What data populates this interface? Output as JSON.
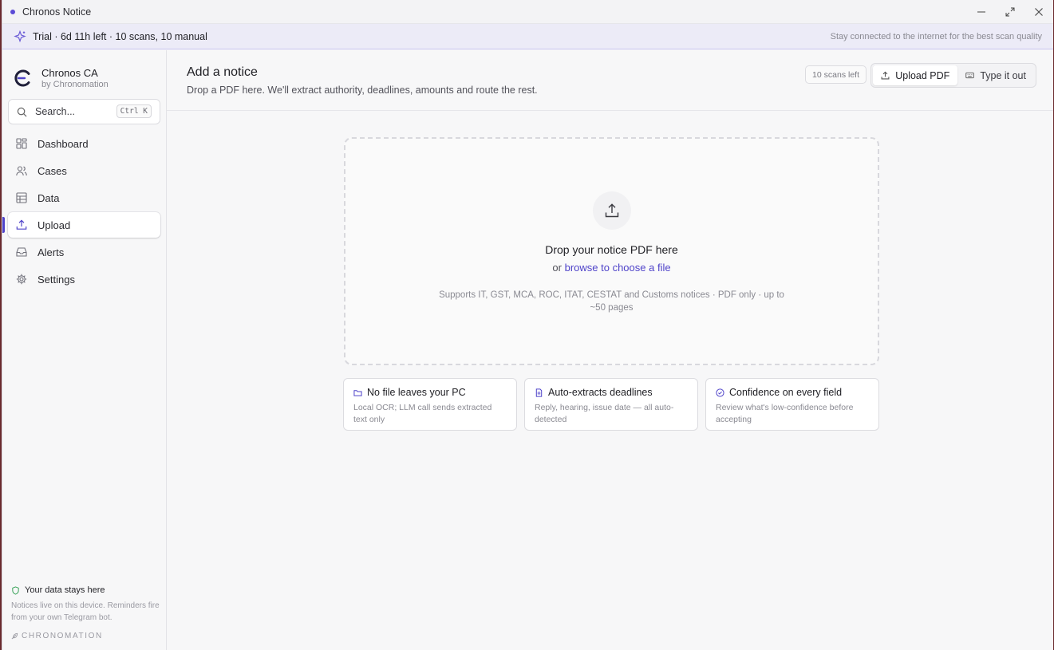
{
  "window": {
    "title": "Chronos Notice"
  },
  "trial": {
    "status": "Trial · 6d 11h left · 10 scans, 10 manual",
    "hint": "Stay connected to the internet for the best scan quality"
  },
  "brand": {
    "name": "Chronos CA",
    "sub": "by Chronomation"
  },
  "search": {
    "placeholder": "Search...",
    "shortcut": "Ctrl K"
  },
  "nav": [
    {
      "label": "Dashboard",
      "icon": "dashboard-icon"
    },
    {
      "label": "Cases",
      "icon": "users-icon"
    },
    {
      "label": "Data",
      "icon": "table-icon"
    },
    {
      "label": "Upload",
      "icon": "upload-icon",
      "active": true
    },
    {
      "label": "Alerts",
      "icon": "inbox-icon"
    },
    {
      "label": "Settings",
      "icon": "gear-icon"
    }
  ],
  "footer": {
    "title": "Your data stays here",
    "text": "Notices live on this device. Reminders fire from your own Telegram bot.",
    "brand": "CHRONOMATION"
  },
  "main": {
    "title": "Add a notice",
    "subtitle": "Drop a PDF here. We'll extract authority, deadlines, amounts and route the rest.",
    "scans_left": "10 scans left",
    "upload_pdf": "Upload PDF",
    "type_it_out": "Type it out"
  },
  "dropzone": {
    "title": "Drop your notice PDF here",
    "or": "or",
    "browse": "browse to choose a file",
    "support": "Supports IT, GST, MCA, ROC, ITAT, CESTAT and Customs notices · PDF only · up to ~50 pages"
  },
  "features": [
    {
      "title": "No file leaves your PC",
      "text": "Local OCR; LLM call sends extracted text only"
    },
    {
      "title": "Auto-extracts deadlines",
      "text": "Reply, hearing, issue date — all auto-detected"
    },
    {
      "title": "Confidence on every field",
      "text": "Review what's low-confidence before accepting"
    }
  ],
  "colors": {
    "accent": "#4f43c9",
    "trial_bg": "#ecebf7",
    "safe": "#3aa35a"
  }
}
